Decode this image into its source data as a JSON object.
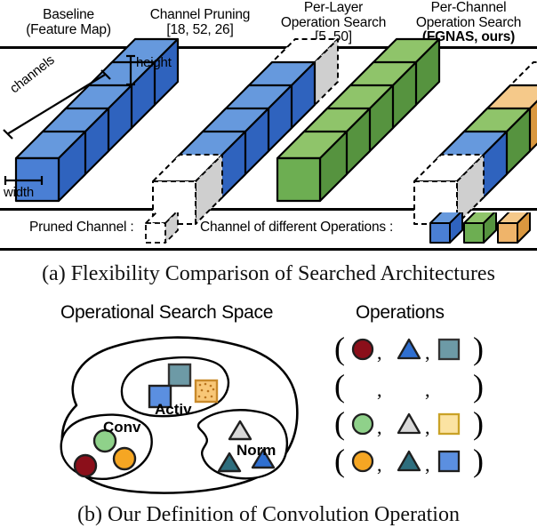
{
  "figure": {
    "panel_a": {
      "columns": [
        {
          "id": "baseline",
          "title_line1": "Baseline",
          "title_line2": "(Feature Map)",
          "title_line2_bold": false,
          "cubes": 5,
          "cube_colors": [
            "blue",
            "blue",
            "blue",
            "blue",
            "blue"
          ],
          "pruned_front": 0,
          "pruned_back": 0
        },
        {
          "id": "channel-pruning",
          "title_line1": "Channel Pruning",
          "title_line2": "[18, 52, 26]",
          "title_line2_bold": false,
          "cubes": 4,
          "cube_colors": [
            "blue",
            "blue",
            "blue",
            "blue"
          ],
          "pruned_front": 1,
          "pruned_back": 1
        },
        {
          "id": "per-layer-operation-search",
          "title_line1": "Per-Layer",
          "title_line2": "Operation Search",
          "title_line3": "[5, 50]",
          "title_line2_bold": false,
          "cubes": 5,
          "cube_colors": [
            "green",
            "green",
            "green",
            "green",
            "green"
          ],
          "pruned_front": 0,
          "pruned_back": 0
        },
        {
          "id": "per-channel-operation-search",
          "title_line1": "Per-Channel",
          "title_line2": "Operation Search",
          "title_line3": "(FGNAS, ours)",
          "title_line3_bold": true,
          "cubes": 3,
          "cube_colors": [
            "blue",
            "green",
            "orange"
          ],
          "pruned_front": 1,
          "pruned_back": 1
        }
      ],
      "axis_labels": {
        "height": "height",
        "width": "width",
        "channels": "channels"
      },
      "legend": {
        "pruned_label": "Pruned Channel :",
        "operations_label": "Channel of different Operations :",
        "operation_cube_colors": [
          "blue",
          "green",
          "orange"
        ]
      }
    },
    "panel_b": {
      "search_space_title": "Operational Search Space",
      "operations_title": "Operations",
      "groups": [
        {
          "name": "Conv",
          "shape": "circle",
          "members": [
            "dark-red",
            "green",
            "orange"
          ]
        },
        {
          "name": "Activ",
          "shape": "square",
          "members": [
            "teal",
            "blue",
            "orange-dotted"
          ]
        },
        {
          "name": "Norm",
          "shape": "triangle",
          "members": [
            "light-gray",
            "teal",
            "blue"
          ]
        }
      ],
      "tuples": [
        {
          "circle": "dark-red",
          "triangle": "blue",
          "square": "teal",
          "empty": false
        },
        {
          "circle": null,
          "triangle": null,
          "square": null,
          "empty": true
        },
        {
          "circle": "green",
          "triangle": "light-gray",
          "square": "light-yellow",
          "empty": false
        },
        {
          "circle": "orange",
          "triangle": "teal",
          "square": "blue",
          "empty": false
        }
      ],
      "tuple_open": "(",
      "tuple_close": ")",
      "tuple_sep": ","
    },
    "captions": {
      "a": "(a) Flexibility Comparison of Searched Architectures",
      "b": "(b) Our Definition of Convolution Operation"
    },
    "colors": {
      "blue_top": "#6699DD",
      "blue_front": "#4A7FD4",
      "blue_side": "#2F63BE",
      "green_top": "#8FC46A",
      "green_front": "#6DAE52",
      "green_side": "#56933F",
      "orange_top": "#F5C98A",
      "orange_front": "#EFB46A",
      "orange_side": "#D9973F",
      "pruned_fill": "#CFCFCF",
      "outline": "#000000",
      "dark_red": "#8B0F1A",
      "mid_green": "#8FD18A",
      "mid_orange": "#F5A623",
      "teal": "#3F7F8C",
      "light_gray": "#D9D9D9",
      "sq_blue": "#5B8FE0",
      "sq_teal": "#6D9AA6",
      "sq_orange_dot": "#F8C777",
      "sq_light_yellow": "#FBE3A2",
      "tri_blue": "#2F6FD0",
      "tri_teal": "#2E6E7E"
    }
  }
}
